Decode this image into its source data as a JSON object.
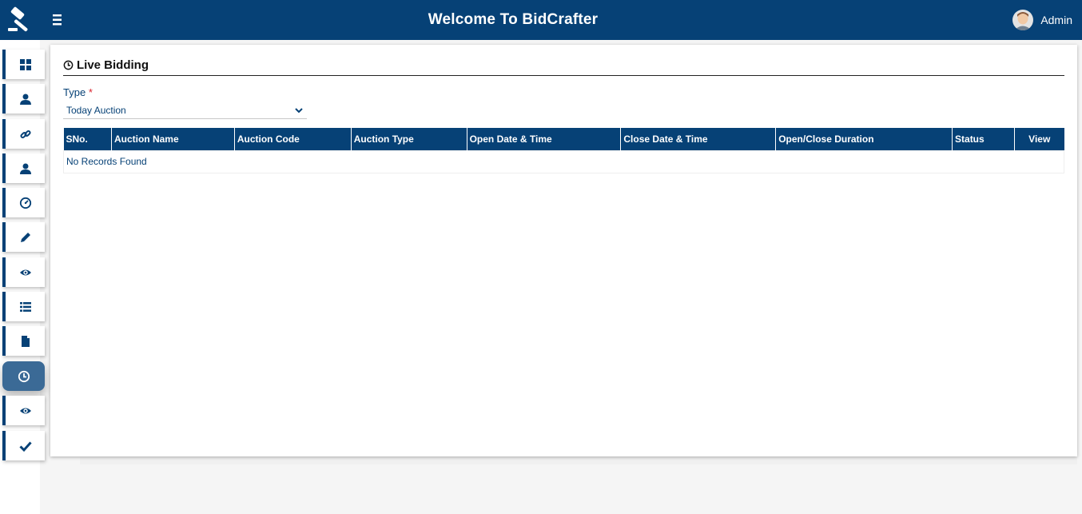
{
  "app": {
    "title": "Welcome To  BidCrafter"
  },
  "header": {
    "user_name": "Admin"
  },
  "sidebar": {
    "items": [
      {
        "icon": "dashboard-icon"
      },
      {
        "icon": "user-icon"
      },
      {
        "icon": "link-icon"
      },
      {
        "icon": "user-icon"
      },
      {
        "icon": "speedometer-icon"
      },
      {
        "icon": "pencil-icon"
      },
      {
        "icon": "eye-icon"
      },
      {
        "icon": "list-icon"
      },
      {
        "icon": "document-icon"
      },
      {
        "icon": "clock-icon",
        "active": true
      },
      {
        "icon": "eye-icon"
      },
      {
        "icon": "check-icon"
      }
    ]
  },
  "page": {
    "title": "Live Bidding",
    "type_label": "Type",
    "required_mark": "*",
    "type_value": "Today Auction"
  },
  "table": {
    "columns": [
      "SNo.",
      "Auction Name",
      "Auction Code",
      "Auction Type",
      "Open Date & Time",
      "Close Date & Time",
      "Open/Close Duration",
      "Status",
      "View"
    ],
    "empty_message": "No Records Found"
  },
  "colors": {
    "primary": "#064176",
    "active_sidebar": "#3b6a96",
    "required": "#d9232d"
  }
}
